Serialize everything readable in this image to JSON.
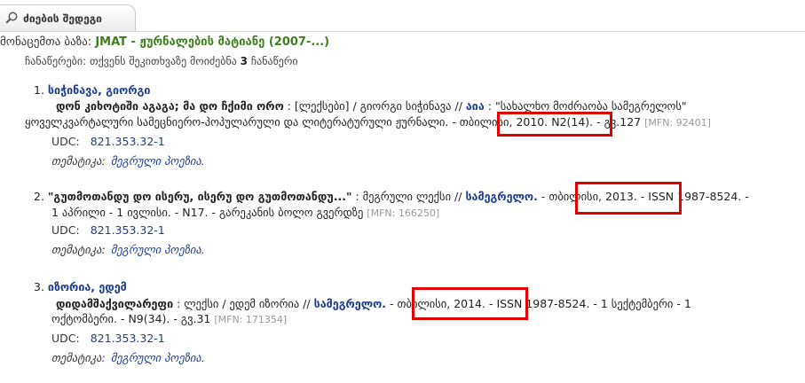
{
  "tab": {
    "label": "ძიების შედეგი",
    "icon": "search-icon"
  },
  "database": {
    "label": "მონაცემთა ბაზა: ",
    "name": "JMAT - ჟურნალების მატიანე (2007-...)"
  },
  "found": {
    "prefix": "ჩანაწერები: თქვენს შეკითხვაზე მოიძებნა ",
    "count": "3",
    "suffix": " ჩანაწერი"
  },
  "records": [
    {
      "number": "1.",
      "author": "სიჭინავა, გიორგი",
      "title": "დონ კიხოტიში აგაგა; მა დო ჩქიმი ორო",
      "desc1": " : [ლექსები] / გიორგი სიჭინავა // ",
      "journal": "აია",
      "desc2": " : \"სახალხო მოძრაობა სამეგრელოს\"",
      "line2": "ყოველკვარტალური სამეცნიერო-პოპულარული და ლიტერატურული ჟურნალი. - ",
      "city": "თბილისი, 2010.",
      "tail": " N2(14). - გვ.127 ",
      "mfn": "[MFN: 92401]",
      "udc_label": "UDC:",
      "udc": "821.353.32-1",
      "theme_label": "თემატიკა:",
      "theme": "მეგრული პოეზია."
    },
    {
      "number": "2.",
      "title": "\"გუთმოთანდუ დო ისერუ, ისერუ დო გუთმოთანდუ...\"",
      "desc1": " : მეგრული ლექსი // ",
      "journal": "სამეგრელო.",
      "dash": " - ",
      "city": "თბილისი, 2013.",
      "tail": " - ISSN 1987-8524. -",
      "line2": "1 აპრილი - 1 ივლისი. - N17. - გარეკანის ბოლო გვერდზე ",
      "mfn": "[MFN: 166250]",
      "udc_label": "UDC:",
      "udc": "821.353.32-1",
      "theme_label": "თემატიკა:",
      "theme": "მეგრული პოეზია."
    },
    {
      "number": "3.",
      "author": "იზორია, ედემ",
      "title": "დიდამშაქვილარეფი",
      "desc1": " : ლექსი / ედემ იზორია // ",
      "journal": "სამეგრელო.",
      "dash": " - ",
      "city": "თბილისი, 2014.",
      "tail": " - ISSN 1987-8524. - 1 სექტემბერი - 1",
      "line2": "ოქტომბერი. - N9(34). - გვ.31 ",
      "mfn": "[MFN: 171354]",
      "udc_label": "UDC:",
      "udc": "821.353.32-1",
      "theme_label": "თემატიკა:",
      "theme": "მეგრული პოეზია."
    }
  ],
  "colors": {
    "author": "#1d3d8f",
    "database": "#3f7f1f",
    "highlight": "#e00000",
    "mfn": "#999999"
  }
}
